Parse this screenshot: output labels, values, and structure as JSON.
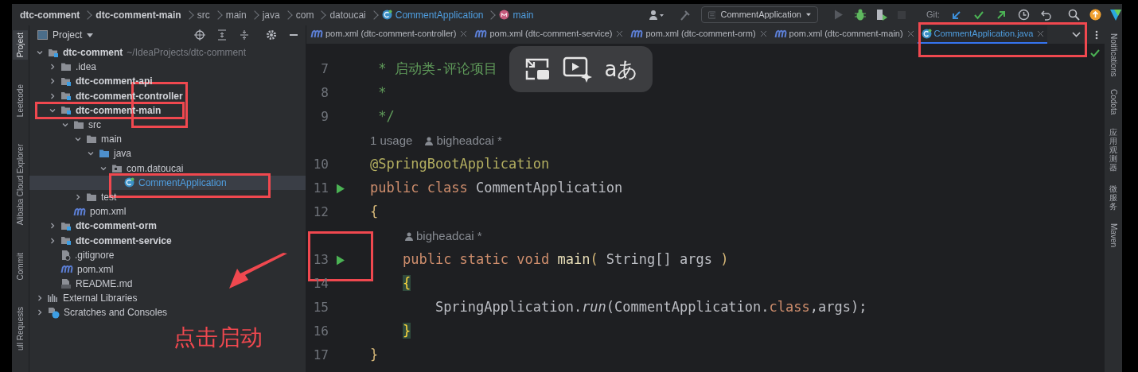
{
  "breadcrumb": [
    {
      "label": "dtc-comment",
      "kind": "bold"
    },
    {
      "label": "dtc-comment-main",
      "kind": "bold"
    },
    {
      "label": "src",
      "kind": "plain"
    },
    {
      "label": "main",
      "kind": "plain"
    },
    {
      "label": "java",
      "kind": "plain"
    },
    {
      "label": "com",
      "kind": "plain"
    },
    {
      "label": "datoucai",
      "kind": "plain"
    },
    {
      "label": "CommentApplication",
      "kind": "class"
    },
    {
      "label": "main",
      "kind": "method"
    }
  ],
  "toolbar": {
    "run_config": "CommentApplication",
    "git_label": "Git:"
  },
  "left_stripe": [
    {
      "label": "Project",
      "selected": true
    },
    {
      "label": "Leetcode",
      "selected": false
    },
    {
      "label": "Alibaba Cloud Explorer",
      "selected": false
    },
    {
      "label": "Commit",
      "selected": false
    },
    {
      "label": "ull Requests",
      "selected": false
    }
  ],
  "right_stripe": [
    {
      "label": "Notifications",
      "kind": "latin"
    },
    {
      "label": "Codota",
      "kind": "latin"
    },
    {
      "label": "应用观测器",
      "kind": "cjk"
    },
    {
      "label": "微服务",
      "kind": "cjk"
    },
    {
      "label": "Maven",
      "kind": "latin"
    }
  ],
  "project_panel": {
    "title": "Project"
  },
  "tree": [
    {
      "label": "dtc-comment",
      "detail": "~/IdeaProjects/dtc-comment",
      "kind": "module",
      "expanded": true,
      "selected": false,
      "children": [
        {
          "label": ".idea",
          "kind": "folder",
          "expanded": false,
          "selected": false
        },
        {
          "label": "dtc-comment-api",
          "kind": "module",
          "expanded": false,
          "selected": false
        },
        {
          "label": "dtc-comment-controller",
          "kind": "module",
          "expanded": false,
          "selected": false
        },
        {
          "label": "dtc-comment-main",
          "kind": "module",
          "expanded": true,
          "selected": false,
          "children": [
            {
              "label": "src",
              "kind": "folder",
              "expanded": true,
              "selected": false,
              "children": [
                {
                  "label": "main",
                  "kind": "folder",
                  "expanded": true,
                  "selected": false,
                  "children": [
                    {
                      "label": "java",
                      "kind": "source",
                      "expanded": true,
                      "selected": false,
                      "children": [
                        {
                          "label": "com.datoucai",
                          "kind": "package",
                          "expanded": true,
                          "selected": false,
                          "children": [
                            {
                              "label": "CommentApplication",
                              "kind": "class",
                              "selected": true
                            }
                          ]
                        }
                      ]
                    }
                  ]
                },
                {
                  "label": "test",
                  "kind": "folder",
                  "expanded": false,
                  "selected": false
                }
              ]
            },
            {
              "label": "pom.xml",
              "kind": "maven",
              "selected": false
            }
          ]
        },
        {
          "label": "dtc-comment-orm",
          "kind": "module",
          "expanded": false,
          "selected": false
        },
        {
          "label": "dtc-comment-service",
          "kind": "module",
          "expanded": false,
          "selected": false
        },
        {
          "label": ".gitignore",
          "kind": "git",
          "selected": false
        },
        {
          "label": "pom.xml",
          "kind": "maven",
          "selected": false
        },
        {
          "label": "README.md",
          "kind": "markdown",
          "selected": false
        }
      ]
    },
    {
      "label": "External Libraries",
      "kind": "libraries",
      "expanded": false,
      "selected": false
    },
    {
      "label": "Scratches and Consoles",
      "kind": "scratches",
      "expanded": false,
      "selected": false
    }
  ],
  "tabs": [
    {
      "label": "pom.xml (dtc-comment-controller)",
      "kind": "maven",
      "selected": false
    },
    {
      "label": "pom.xml (dtc-comment-service)",
      "kind": "maven",
      "selected": false
    },
    {
      "label": "pom.xml (dtc-comment-orm)",
      "kind": "maven",
      "selected": false
    },
    {
      "label": "pom.xml (dtc-comment-main)",
      "kind": "maven",
      "selected": false
    },
    {
      "label": "CommentApplication.java",
      "kind": "class",
      "selected": true
    }
  ],
  "code": [
    {
      "kind": "code",
      "number": "7",
      "run": false,
      "tokens": [
        {
          "text": " * 启动类-评论项目",
          "kind": "comment"
        }
      ]
    },
    {
      "kind": "code",
      "number": "8",
      "run": false,
      "tokens": [
        {
          "text": " *",
          "kind": "comment"
        }
      ]
    },
    {
      "kind": "code",
      "number": "9",
      "run": false,
      "tokens": [
        {
          "text": " */",
          "kind": "comment"
        }
      ]
    },
    {
      "kind": "hint",
      "hints": [
        {
          "text": "1 usage",
          "kind": "usage"
        },
        {
          "text": "bigheadcai *",
          "kind": "author"
        }
      ]
    },
    {
      "kind": "code",
      "number": "10",
      "run": false,
      "tokens": [
        {
          "text": "@SpringBootApplication",
          "kind": "annotation"
        }
      ]
    },
    {
      "kind": "code",
      "number": "11",
      "run": true,
      "tokens": [
        {
          "text": "public class ",
          "kind": "keyword"
        },
        {
          "text": "CommentApplication",
          "kind": "plain"
        }
      ]
    },
    {
      "kind": "code",
      "number": "12",
      "run": false,
      "tokens": [
        {
          "text": "{",
          "kind": "punct"
        }
      ]
    },
    {
      "kind": "hint",
      "hints": [
        {
          "text": "bigheadcai *",
          "kind": "author"
        }
      ]
    },
    {
      "kind": "code",
      "number": "13",
      "run": true,
      "tokens": [
        {
          "text": "    public static void ",
          "kind": "keyword"
        },
        {
          "text": "main",
          "kind": "decl"
        },
        {
          "text": "( ",
          "kind": "punct"
        },
        {
          "text": "String[] args ",
          "kind": "plain"
        },
        {
          "text": ")",
          "kind": "punct"
        }
      ]
    },
    {
      "kind": "code",
      "number": "14",
      "run": false,
      "tokens": [
        {
          "text": "    {",
          "kind": "brace"
        }
      ]
    },
    {
      "kind": "code",
      "number": "15",
      "run": false,
      "tokens": [
        {
          "text": "        SpringApplication.",
          "kind": "plain"
        },
        {
          "text": "run",
          "kind": "italic"
        },
        {
          "text": "(CommentApplication.",
          "kind": "plain"
        },
        {
          "text": "class",
          "kind": "keyword"
        },
        {
          "text": ",args);",
          "kind": "plain"
        }
      ]
    },
    {
      "kind": "code",
      "number": "16",
      "run": false,
      "tokens": [
        {
          "text": "    }",
          "kind": "brace"
        }
      ]
    },
    {
      "kind": "code",
      "number": "17",
      "run": false,
      "tokens": [
        {
          "text": "}",
          "kind": "punct"
        }
      ]
    }
  ],
  "overlay": {
    "translate_label": "aあ"
  },
  "annotation": {
    "caption": "点击启动"
  }
}
